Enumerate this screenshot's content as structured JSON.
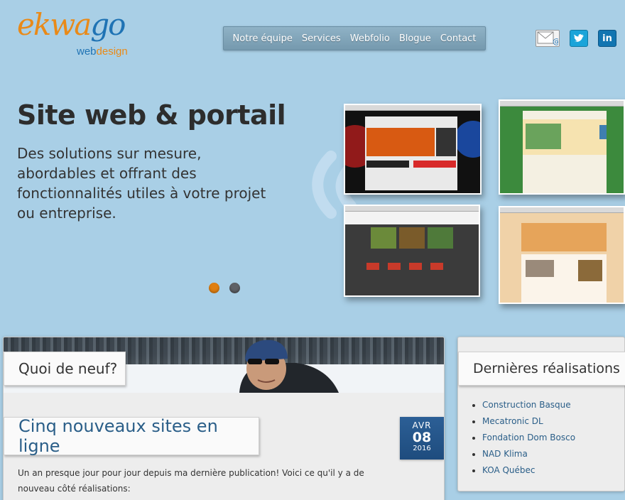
{
  "logo": {
    "wordmark_a": "ekwa",
    "wordmark_b": "go",
    "sub_a": "web",
    "sub_b": "design"
  },
  "nav": {
    "items": [
      "Notre équipe",
      "Services",
      "Webfolio",
      "Blogue",
      "Contact"
    ]
  },
  "social": {
    "icons": [
      "mail-icon",
      "twitter-icon",
      "linkedin-icon"
    ],
    "linkedin_text": "in"
  },
  "hero": {
    "title": "Site web & portail",
    "text": "Des solutions sur mesure, abordables et offrant des fonctionnalités utiles à votre projet ou entreprise."
  },
  "slider": {
    "active_index": 0,
    "count": 2
  },
  "news": {
    "heading": "Quoi de neuf?",
    "post_title": "Cinq nouveaux sites en ligne",
    "date": {
      "month": "AVR",
      "day": "08",
      "year": "2016"
    },
    "excerpt": "Un an presque jour pour jour depuis ma dernière publication! Voici ce qu'il y a de nouveau côté réalisations:"
  },
  "recent": {
    "heading": "Dernières réalisations",
    "items": [
      "Construction Basque",
      "Mecatronic DL",
      "Fondation Dom Bosco",
      "NAD Klima",
      "KOA Québec"
    ]
  },
  "colors": {
    "background": "#a9cfe6",
    "accent_orange": "#e07f11",
    "link_blue": "#2a5e88",
    "date_blue": "#2c5f96"
  }
}
